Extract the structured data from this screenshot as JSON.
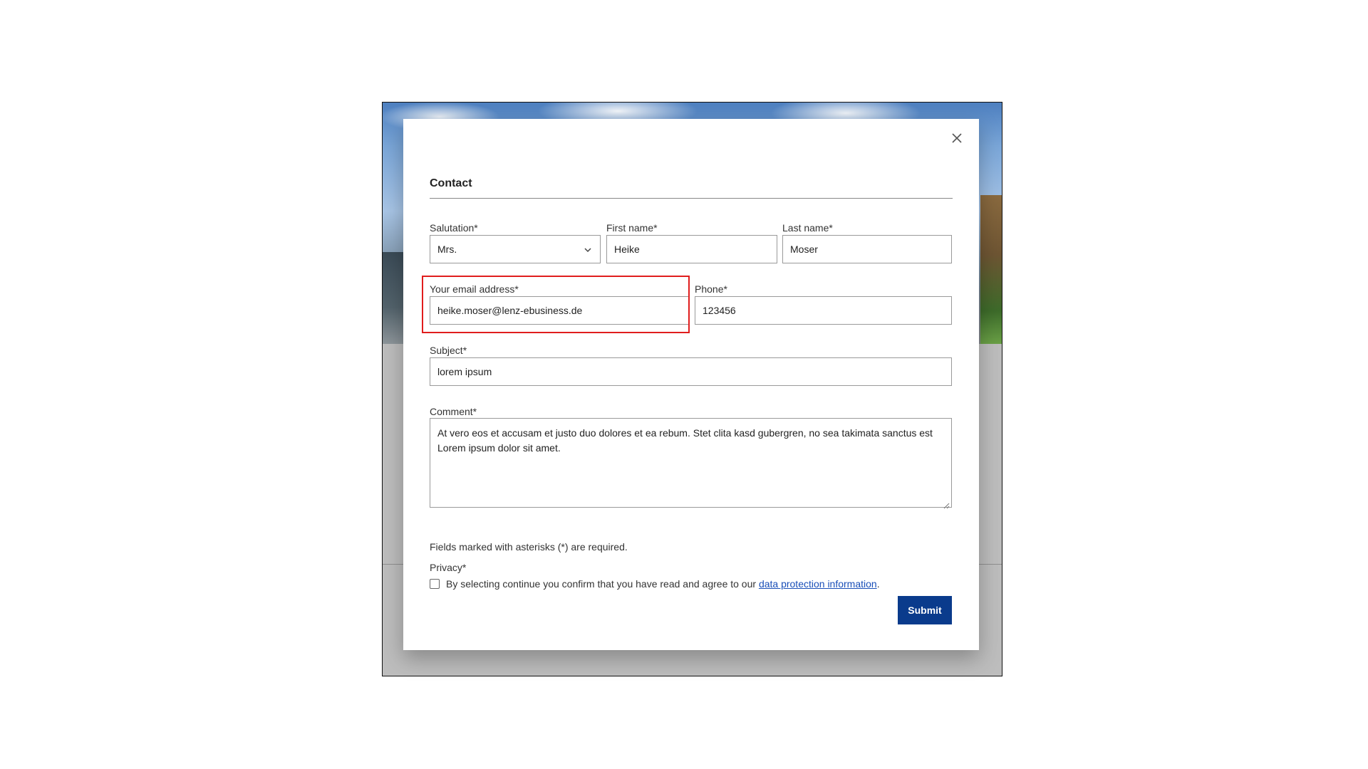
{
  "modal": {
    "title": "Contact",
    "close_icon": "close-icon"
  },
  "form": {
    "salutation": {
      "label": "Salutation*",
      "value": "Mrs.",
      "icon": "chevron-down-icon"
    },
    "first_name": {
      "label": "First name*",
      "value": "Heike"
    },
    "last_name": {
      "label": "Last name*",
      "value": "Moser"
    },
    "email": {
      "label": "Your email address*",
      "value": "heike.moser@lenz-ebusiness.de"
    },
    "phone": {
      "label": "Phone*",
      "value": "123456"
    },
    "subject": {
      "label": "Subject*",
      "value": "lorem ipsum"
    },
    "comment": {
      "label": "Comment*",
      "value": "At vero eos et accusam et justo duo dolores et ea rebum. Stet clita kasd gubergren, no sea takimata sanctus est Lorem ipsum dolor sit amet."
    },
    "required_note": "Fields marked with asterisks (*) are required.",
    "privacy": {
      "label": "Privacy*",
      "text_before": "By selecting continue you confirm that you have read and agree to our ",
      "link_text": "data protection information",
      "text_after": ".",
      "checked": false
    },
    "submit_label": "Submit"
  },
  "colors": {
    "highlight": "#e01d1d",
    "submit_bg": "#0a3b8c",
    "link": "#1a4fb8"
  }
}
